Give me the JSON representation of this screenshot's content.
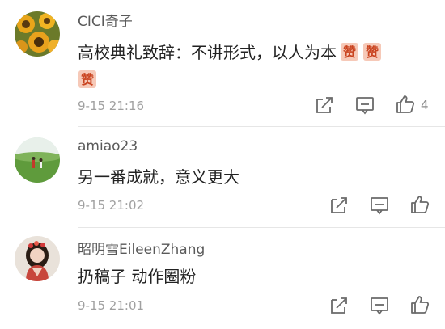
{
  "comments": [
    {
      "username": "CICI奇子",
      "text_line1": "高校典礼致辞：不讲形式，以人为本",
      "time": "9-15 21:16",
      "like_count": "4",
      "emoji": "zan-emoji",
      "avatar": "sunflower-avatar"
    },
    {
      "username": "amiao23",
      "text_line1": "另一番成就，意义更大",
      "time": "9-15 21:02",
      "avatar": "meadow-avatar"
    },
    {
      "username": "昭明雪EileenZhang",
      "text_line1": "扔稿子 动作圈粉",
      "time": "9-15 21:01",
      "avatar": "girl-avatar"
    }
  ],
  "icons": {
    "share": "share-icon",
    "comment": "comment-icon",
    "like": "thumbs-up-icon"
  },
  "colors": {
    "text": "#222222",
    "username": "#5a5a5a",
    "meta": "#a0a0a0",
    "divider": "#e6e6e6"
  }
}
